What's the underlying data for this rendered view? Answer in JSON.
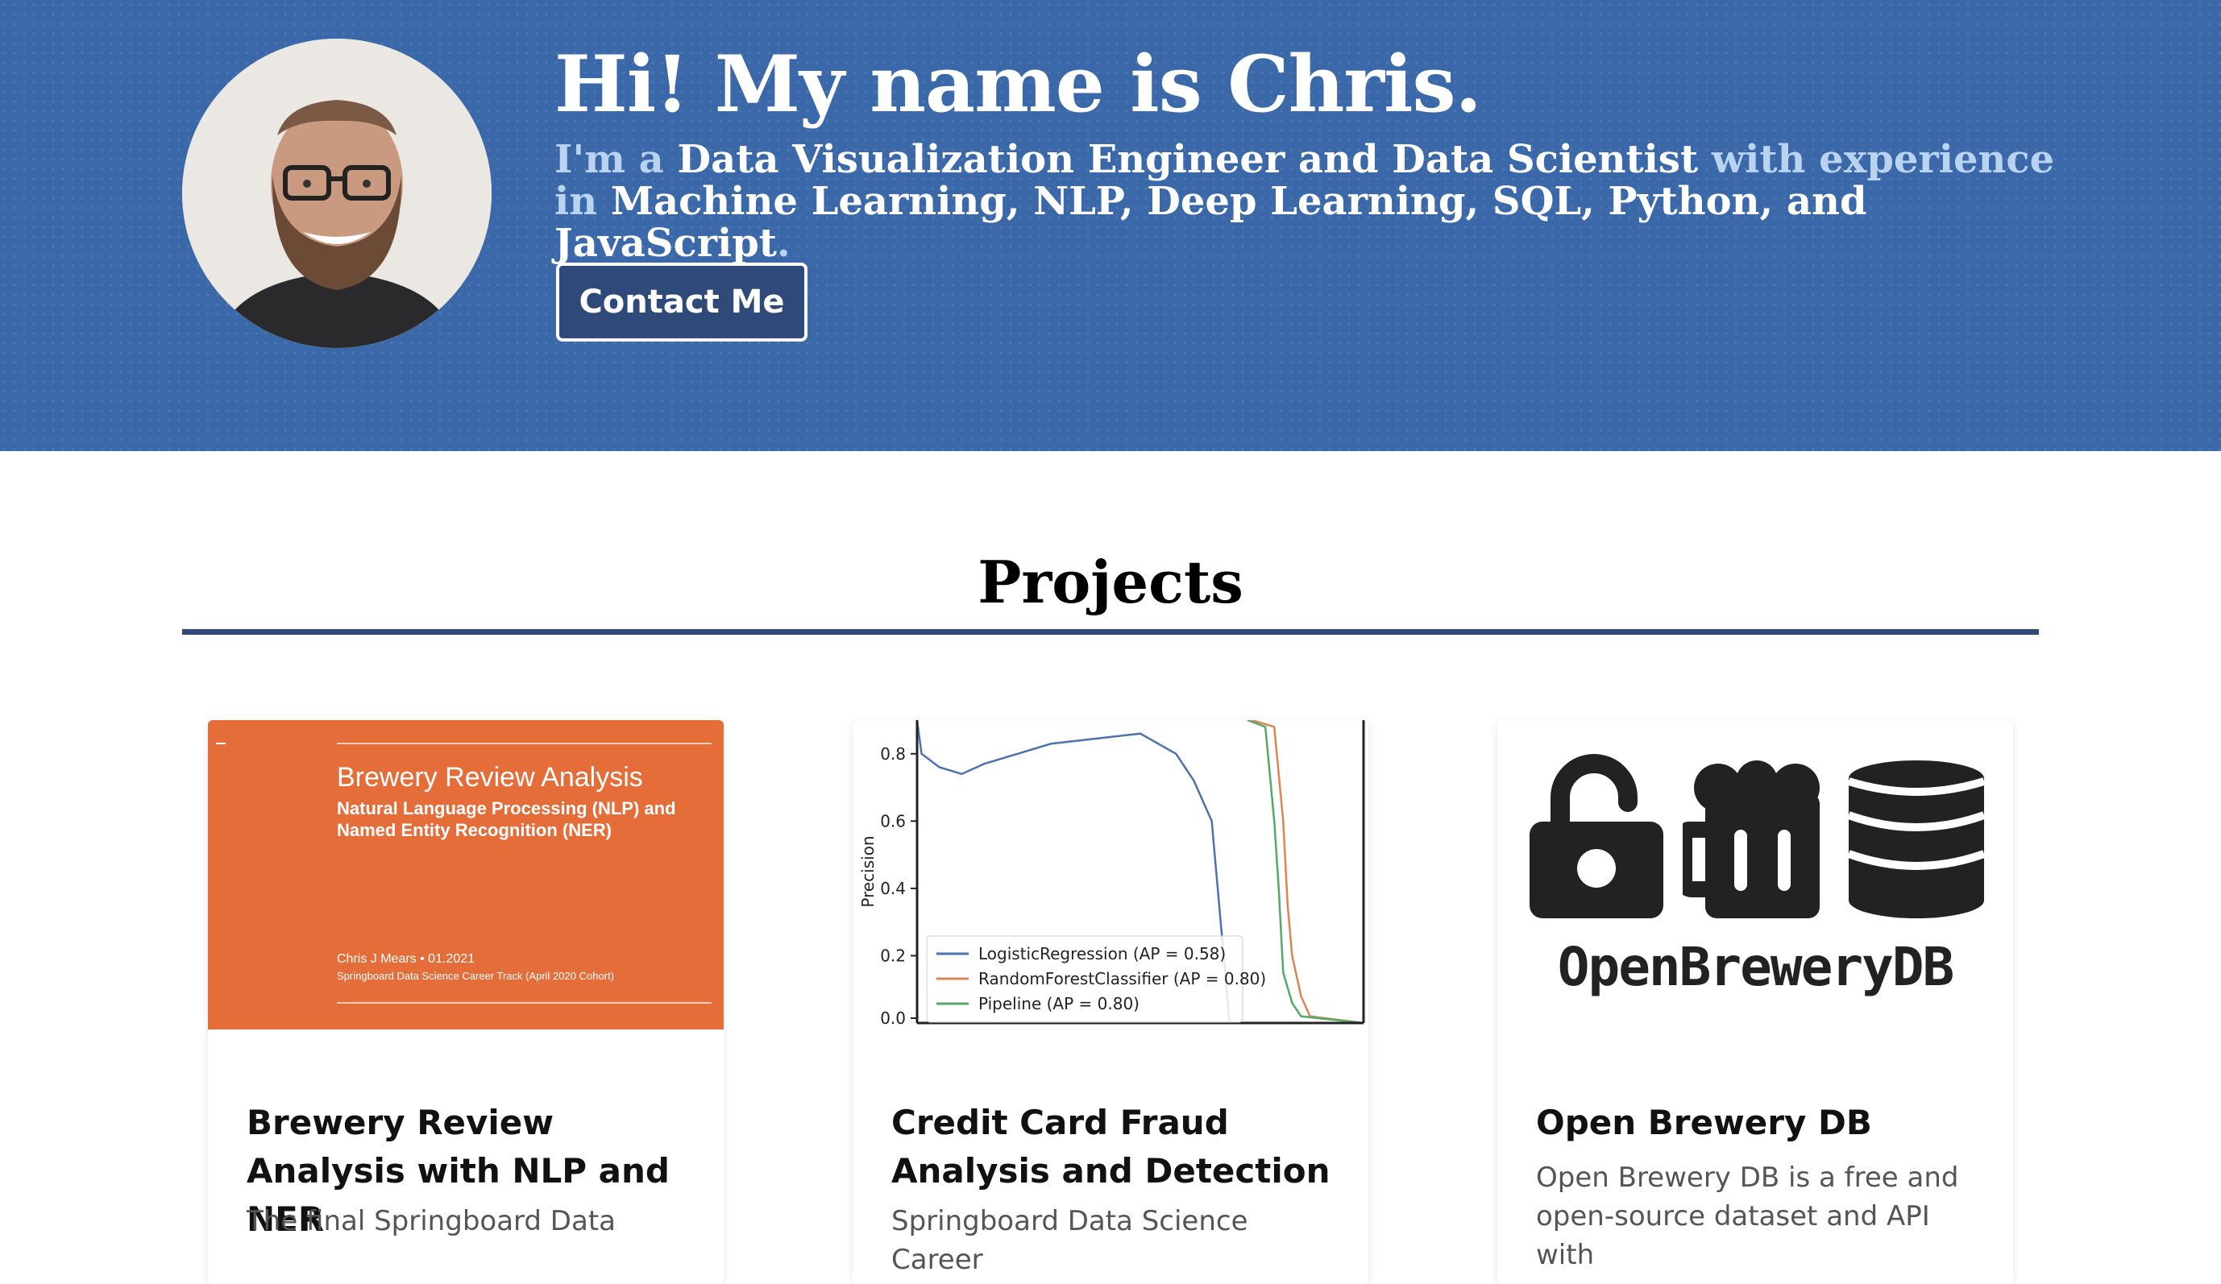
{
  "hero": {
    "title": "Hi! My name is Chris.",
    "subtitle_parts": [
      {
        "text": "I'm a ",
        "style": "light"
      },
      {
        "text": "Data Visualization Engineer and Data Scientist",
        "style": "bold"
      },
      {
        "text": " with experience in ",
        "style": "light"
      },
      {
        "text": "Machine Learning, NLP, Deep Learning, SQL, Python, and JavaScript",
        "style": "bold"
      },
      {
        "text": ".",
        "style": "light"
      }
    ],
    "contact_label": "Contact Me",
    "colors": {
      "background": "#3a68a8",
      "button": "#2f4a78",
      "accent_text": "#b9d3f0"
    }
  },
  "projects": {
    "heading": "Projects",
    "cards": [
      {
        "title": "Brewery Review Analysis with NLP and NER",
        "description": "The final Springboard Data",
        "image": {
          "kind": "slide",
          "title": "Brewery Review Analysis",
          "subtitle": "Natural Language Processing (NLP) and Named Entity Recognition (NER)",
          "author": "Chris J Mears • 01.2021",
          "track": "Springboard Data Science Career Track (April 2020 Cohort)",
          "background": "#e56d3a"
        }
      },
      {
        "title": "Credit Card Fraud Analysis and Detection",
        "description": "Springboard Data Science Career",
        "image": {
          "kind": "precision-recall-chart"
        }
      },
      {
        "title": "Open Brewery DB",
        "description": "Open Brewery DB is a free and open-source dataset and API with",
        "image": {
          "kind": "logo",
          "logo_text": "OpenBreweryDB",
          "icons": [
            "unlocked-padlock-icon",
            "beer-mug-icon",
            "database-icon"
          ]
        }
      }
    ]
  },
  "chart_data": {
    "type": "line",
    "ylabel": "Precision",
    "xlabel": "",
    "ylim": [
      0,
      0.9
    ],
    "yticks": [
      "0.0",
      "0.2",
      "0.4",
      "0.6",
      "0.8"
    ],
    "legend_position": "lower-left",
    "series": [
      {
        "name": "LogisticRegression (AP = 0.58)",
        "color": "#4c72b0",
        "points": [
          [
            0.0,
            0.9
          ],
          [
            0.01,
            0.8
          ],
          [
            0.03,
            0.78
          ],
          [
            0.05,
            0.76
          ],
          [
            0.1,
            0.74
          ],
          [
            0.15,
            0.77
          ],
          [
            0.3,
            0.83
          ],
          [
            0.5,
            0.86
          ],
          [
            0.58,
            0.8
          ],
          [
            0.62,
            0.72
          ],
          [
            0.66,
            0.6
          ],
          [
            0.68,
            0.3
          ],
          [
            0.7,
            0.0
          ]
        ]
      },
      {
        "name": "RandomForestClassifier (AP = 0.80)",
        "color": "#dd8452",
        "points": [
          [
            0.75,
            0.9
          ],
          [
            0.8,
            0.88
          ],
          [
            0.82,
            0.6
          ],
          [
            0.83,
            0.35
          ],
          [
            0.84,
            0.2
          ],
          [
            0.86,
            0.08
          ],
          [
            0.88,
            0.02
          ],
          [
            1.0,
            0.0
          ]
        ]
      },
      {
        "name": "Pipeline (AP = 0.80)",
        "color": "#55a868",
        "points": [
          [
            0.74,
            0.9
          ],
          [
            0.78,
            0.88
          ],
          [
            0.8,
            0.6
          ],
          [
            0.81,
            0.4
          ],
          [
            0.82,
            0.15
          ],
          [
            0.84,
            0.06
          ],
          [
            0.86,
            0.02
          ],
          [
            1.0,
            0.0
          ]
        ]
      }
    ]
  }
}
